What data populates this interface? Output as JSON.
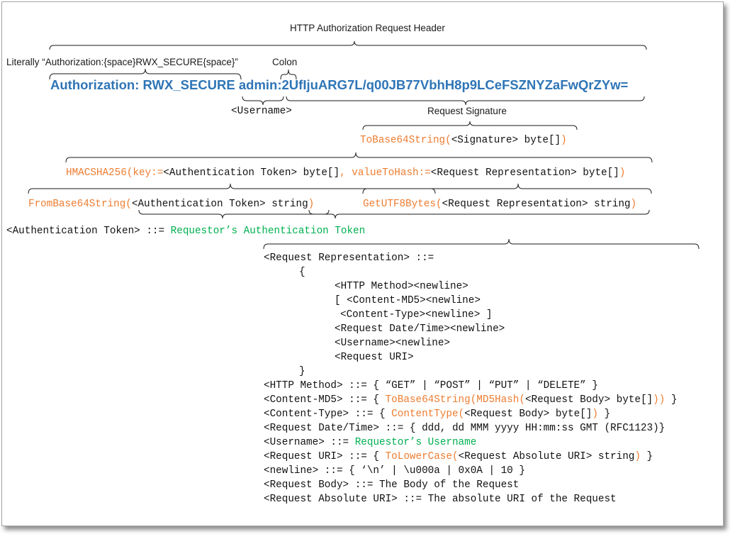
{
  "header": {
    "title": "HTTP Authorization Request Header",
    "literal": "Literally “Authorization:{space}RWX_SECURE{space}”",
    "colon": "Colon"
  },
  "auth": {
    "prefix": "Authorization: RWX_SECURE",
    "user": "admin",
    "colon": ":",
    "signature": "2UfIjuARG7L/q00JB77VbhH8p9LCeFSZNYZaFwQrZYw="
  },
  "labels": {
    "username": "<Username>",
    "signature": "Request Signature"
  },
  "sig_line": {
    "fn": "ToBase64String(",
    "arg": "<Signature> byte[]",
    "close": ")"
  },
  "hmac_line": {
    "fn": "HMACSHA256(key:=",
    "arg1": "<Authentication Token> byte[]",
    "sep": ", valueToHash:=",
    "arg2": "<Request Representation> byte[]",
    "close": ")"
  },
  "frombase_line": {
    "fn": "FromBase64String(",
    "arg": "<Authentication Token> string",
    "close": ")"
  },
  "utf8_line": {
    "fn": "GetUTF8Bytes(",
    "arg": "<Request Representation> string",
    "close": ")"
  },
  "token_def": {
    "lhs": "<Authentication Token> ::= ",
    "rhs": "Requestor’s Authentication Token"
  },
  "reqrep": {
    "head": "<Request Representation> ::=",
    "open": "{",
    "items": [
      "<HTTP Method><newline>",
      "[ <Content-MD5><newline>",
      "<Content-Type><newline> ]",
      "<Request Date/Time><newline>",
      "<Username><newline>",
      "<Request URI>"
    ],
    "close": "}"
  },
  "defs": {
    "method": "<HTTP Method> ::= { “GET” | “POST” | “PUT” | “DELETE” }",
    "md5_a": "<Content-MD5> ::= { ",
    "md5_b": "ToBase64String(MD5Hash(",
    "md5_c": "<Request Body> byte[]",
    "md5_d": "))",
    "md5_e": " }",
    "ctype_a": "<Content-Type> ::= { ",
    "ctype_b": "ContentType(",
    "ctype_c": "<Request Body> byte[]",
    "ctype_d": ")",
    "ctype_e": " }",
    "date": "<Request Date/Time> ::= { ddd, dd MMM yyyy HH:mm:ss GMT (RFC1123)}",
    "user_a": "<Username> ::= ",
    "user_b": "Requestor’s Username",
    "uri_a": "<Request URI> ::= { ",
    "uri_b": "ToLowerCase(",
    "uri_c": "<Request Absolute URI> string",
    "uri_d": ")",
    "uri_e": " }",
    "newline": "<newline> ::= { ‘\\n’ | \\u000a | 0x0A | 10 }",
    "body": "<Request Body> ::= The Body of the Request",
    "absuri": "<Request Absolute URI> ::= The absolute URI of the Request"
  },
  "colors": {
    "blue": "#2e75b6",
    "orange": "#ed7d31",
    "green": "#00b050"
  }
}
